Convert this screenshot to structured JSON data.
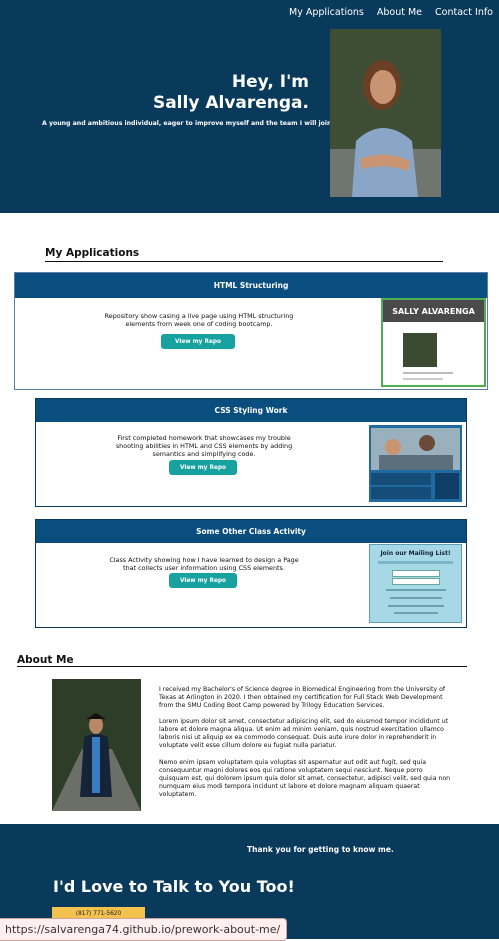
{
  "nav": {
    "items": [
      "My Applications",
      "About Me",
      "Contact Info"
    ]
  },
  "hero": {
    "greeting": "Hey, I'm",
    "name": "Sally Alvarenga.",
    "tagline": "A young and ambitious individual, eager to improve myself and the team I will join."
  },
  "applications": {
    "heading": "My Applications",
    "cards": [
      {
        "title": "HTML Structuring",
        "description": "Repository show casing a live page using HTML structuring elements from week one of coding bootcamp.",
        "button": "View my Repo",
        "thumb_banner": "SALLY ALVARENGA"
      },
      {
        "title": "CSS Styling Work",
        "description": "First completed homework that showcases my trouble shooting abilities in HTML and CSS elements by adding semantics and simplifying code.",
        "button": "View my Repo"
      },
      {
        "title": "Some Other Class Activity",
        "description": "Class Activity showing how I have learned to design a Page that collects user information using CSS elements.",
        "button": "View my Repo",
        "thumb_title": "Join our Mailing List!"
      }
    ]
  },
  "about": {
    "heading": "About Me",
    "paragraphs": [
      "I received my Bachelor's of Science degree in Biomedical Engineering from the University of Texas at Arlington in 2020. I then obtained my certification for Full Stack Web Development from the SMU Coding Boot Camp powered by Trilogy Education Services.",
      "Lorem ipsum dolor sit amet, consectetur adipiscing elit, sed do eiusmod tempor incididunt ut labore et dolore magna aliqua. Ut enim ad minim veniam, quis nostrud exercitation ullamco laboris nisi ut aliquip ex ea commodo consequat. Duis aute irure dolor in reprehenderit in voluptate velit esse cillum dolore eu fugiat nulla pariatur.",
      "Nemo enim ipsam voluptatem quia voluptas sit aspernatur aut odit aut fugit, sed quia consequuntur magni dolores eos qui ratione voluptatem sequi nesciunt. Neque porro quisquam est, qui dolorem ipsum quia dolor sit amet, consectetur, adipisci velit, sed quia non numquam eius modi tempora incidunt ut labore et dolore magnam aliquam quaerat voluptatem."
    ]
  },
  "footer": {
    "thanks": "Thank you for getting to know me.",
    "headline": "I'd Love to Talk to You Too!",
    "phone": "(817) 771-5620"
  },
  "status_bar": {
    "url": "https://salvarenga74.github.io/prework-about-me/"
  },
  "colors": {
    "navy": "#0a3a5b",
    "card_header": "#0a4e80",
    "teal_button": "#17a2a0",
    "phone_button": "#f3c14e"
  }
}
